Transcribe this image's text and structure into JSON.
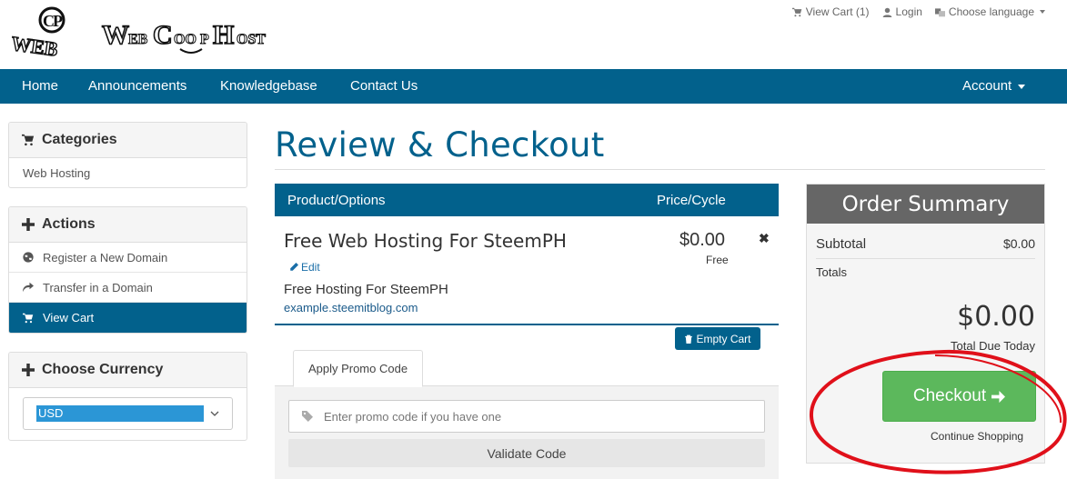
{
  "brand": {
    "logo_text": "WebCoopHost",
    "logo_sub": "WEB"
  },
  "topbar": {
    "view_cart": "View Cart (1)",
    "login": "Login",
    "language": "Choose language"
  },
  "nav": {
    "items": [
      "Home",
      "Announcements",
      "Knowledgebase",
      "Contact Us"
    ],
    "account": "Account"
  },
  "sidebar": {
    "categories": {
      "title": "Categories",
      "items": [
        "Web Hosting"
      ]
    },
    "actions": {
      "title": "Actions",
      "items": [
        "Register a New Domain",
        "Transfer in a Domain",
        "View Cart"
      ]
    },
    "currency": {
      "title": "Choose Currency",
      "selected": "USD"
    }
  },
  "main": {
    "title": "Review & Checkout",
    "table": {
      "col_product": "Product/Options",
      "col_price": "Price/Cycle"
    },
    "item": {
      "name": "Free Web Hosting For SteemPH",
      "edit": "Edit",
      "description": "Free Hosting For SteemPH",
      "domain": "example.steemitblog.com",
      "price": "$0.00",
      "cycle": "Free",
      "remove_symbol": "✖"
    },
    "empty_cart": "Empty Cart",
    "promo": {
      "tab": "Apply Promo Code",
      "placeholder": "Enter promo code if you have one",
      "validate": "Validate Code"
    }
  },
  "summary": {
    "title": "Order Summary",
    "subtotal_label": "Subtotal",
    "subtotal_value": "$0.00",
    "totals_label": "Totals",
    "total_value": "$0.00",
    "total_label": "Total Due Today",
    "checkout": "Checkout",
    "continue": "Continue Shopping"
  },
  "colors": {
    "nav": "#02618c",
    "checkout": "#5cb85c",
    "summary_head": "#666666",
    "annotation": "#e0101a"
  },
  "icons": [
    "cart-icon",
    "user-icon",
    "language-icon",
    "plus-icon",
    "globe-icon",
    "share-icon",
    "pencil-icon",
    "trash-icon",
    "tag-icon",
    "arrow-right-icon"
  ]
}
